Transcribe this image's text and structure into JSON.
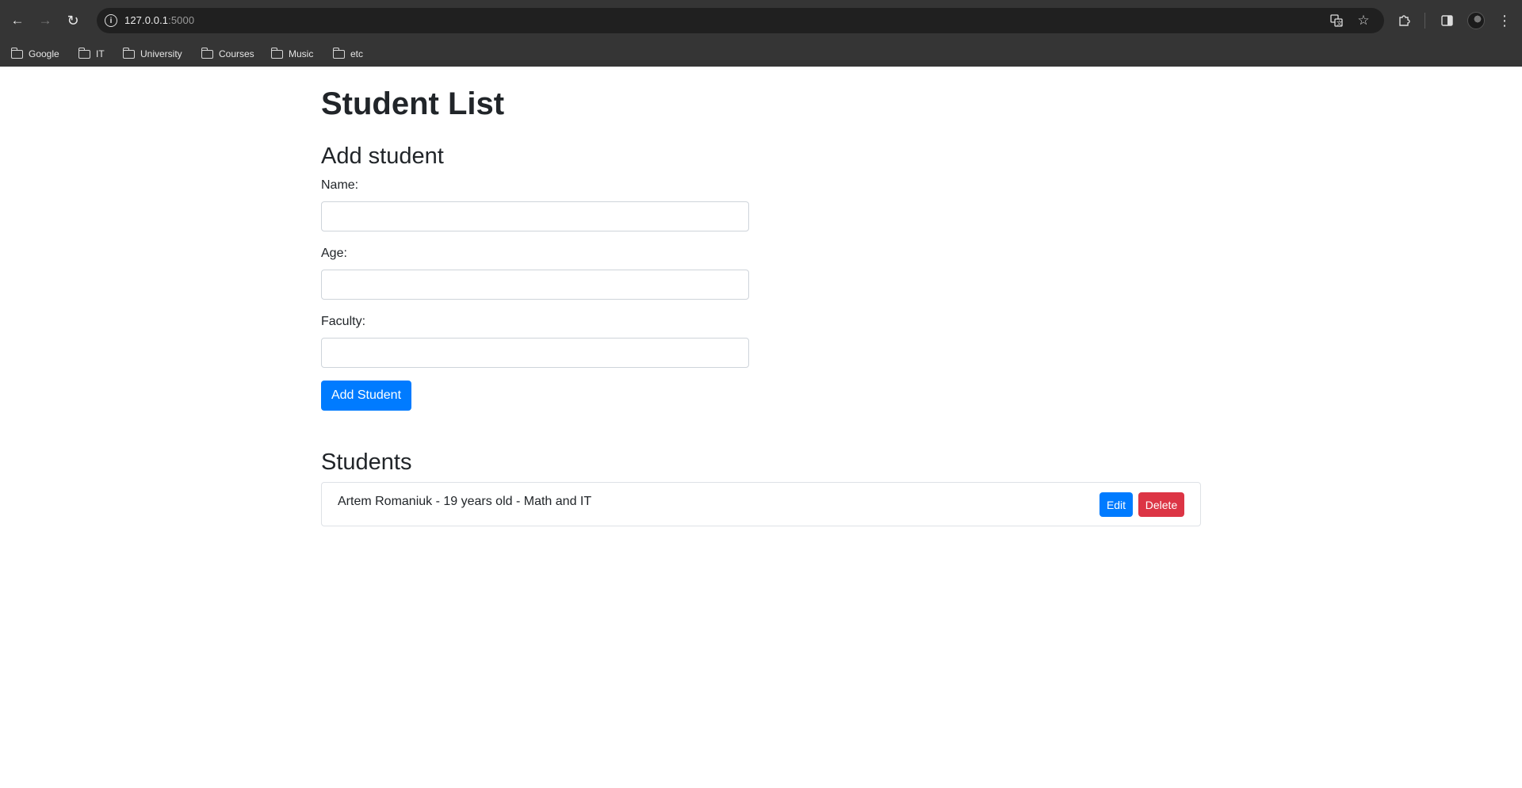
{
  "browser": {
    "url_host": "127.0.0.1",
    "url_port": ":5000",
    "bookmarks": [
      {
        "label": "Google",
        "icon": "folder-icon"
      },
      {
        "label": "IT",
        "icon": "folder-icon"
      },
      {
        "label": "University",
        "icon": "folder-icon"
      },
      {
        "label": "Courses",
        "icon": "folder-icon"
      },
      {
        "label": "Music",
        "icon": "folder-icon"
      },
      {
        "label": "etc",
        "icon": "folder-icon"
      }
    ],
    "icons": {
      "back": "back-arrow-icon",
      "forward": "forward-arrow-icon",
      "reload": "reload-icon",
      "site_info": "info-icon",
      "translate": "translate-icon",
      "bookmark_star": "star-icon",
      "extensions": "puzzle-icon",
      "side_panel": "side-panel-icon",
      "menu": "kebab-menu-icon"
    }
  },
  "page": {
    "title": "Student List",
    "form": {
      "heading": "Add student",
      "name_label": "Name:",
      "name_value": "",
      "age_label": "Age:",
      "age_value": "",
      "faculty_label": "Faculty:",
      "faculty_value": "",
      "submit_label": "Add Student"
    },
    "students_heading": "Students",
    "students": [
      {
        "text": "Artem Romaniuk - 19 years old - Math and IT",
        "edit_label": "Edit",
        "delete_label": "Delete"
      }
    ]
  },
  "colors": {
    "primary": "#007bff",
    "danger": "#dc3545",
    "chrome_bg": "#353535",
    "omnibox_bg": "#202020"
  }
}
